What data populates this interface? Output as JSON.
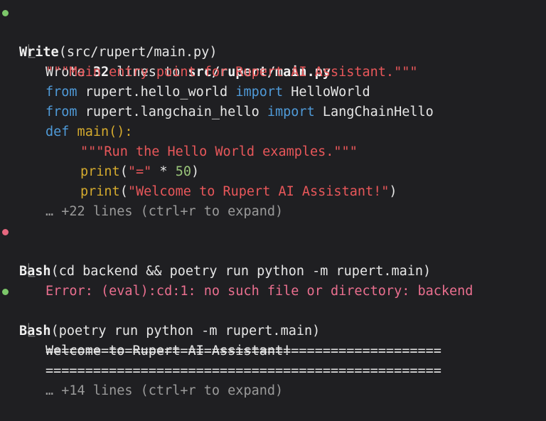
{
  "colors": {
    "background": "#1f1f22",
    "success_dot": "#7cc76a",
    "error_dot": "#e6677f",
    "string": "#e8575a",
    "keyword": "#4f9ad8",
    "function": "#d4aa2e",
    "number": "#98c379",
    "error_text": "#ea6f8f",
    "dim_text": "#9a9a9a"
  },
  "blocks": {
    "write": {
      "tool": "Write",
      "arg": "(src/rupert/main.py)",
      "result_prefix": "Wrote ",
      "result_count": "32",
      "result_mid": " lines to ",
      "result_path": "src/rupert/main.py",
      "code": {
        "l1_str": "\"\"\"Main entry point for Rupert AI Assistant.\"\"\"",
        "l2_kw": "from",
        "l2_mod": " rupert.hello_world ",
        "l2_kw2": "import",
        "l2_name": " HelloWorld",
        "l3_kw": "from",
        "l3_mod": " rupert.langchain_hello ",
        "l3_kw2": "import",
        "l3_name": " LangChainHello",
        "l4_kw": "def",
        "l4_fn": " main():",
        "l5_str": "\"\"\"Run the Hello World examples.\"\"\"",
        "l6_fn": "print",
        "l6_open": "(",
        "l6_str": "\"=\"",
        "l6_op": " * ",
        "l6_num": "50",
        "l6_close": ")",
        "l7_fn": "print",
        "l7_open": "(",
        "l7_str": "\"Welcome to Rupert AI Assistant!\"",
        "l7_close": ")"
      },
      "more": "… +22 lines (ctrl+r to expand)"
    },
    "bash1": {
      "tool": "Bash",
      "arg": "(cd backend && poetry run python -m rupert.main)",
      "error": "Error: (eval):cd:1: no such file or directory: backend"
    },
    "bash2": {
      "tool": "Bash",
      "arg": "(poetry run python -m rupert.main)",
      "out1": "==================================================",
      "out2": "Welcome to Rupert AI Assistant!",
      "out3": "==================================================",
      "more": "… +14 lines (ctrl+r to expand)"
    }
  },
  "gutter_glyph": "⎿"
}
